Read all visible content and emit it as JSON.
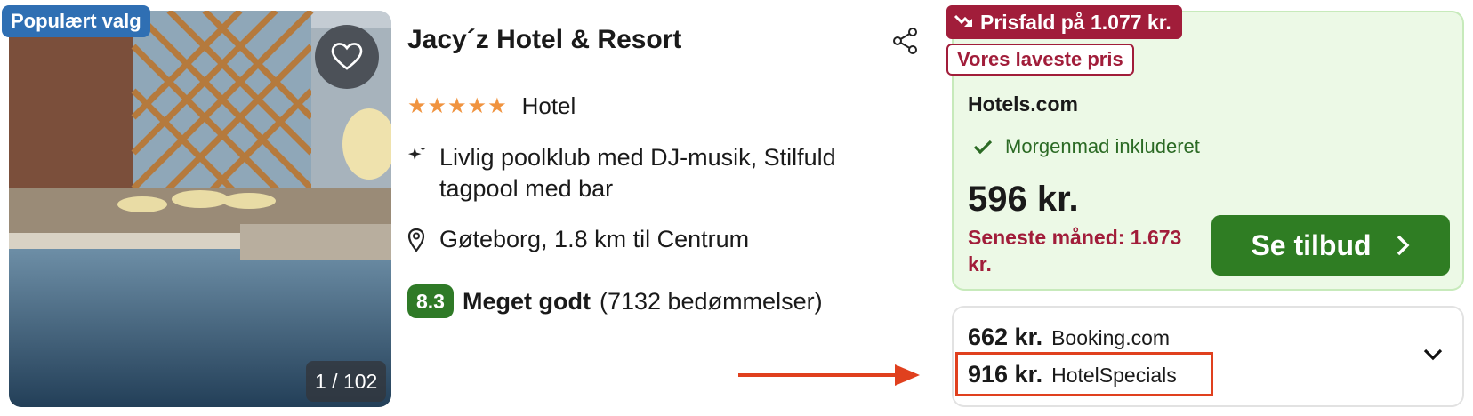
{
  "badges": {
    "popular": "Populært valg",
    "price_drop": "Prisfald på 1.077 kr.",
    "lowest": "Vores laveste pris"
  },
  "gallery": {
    "counter": "1 / 102"
  },
  "hotel": {
    "name": "Jacy´z Hotel & Resort",
    "stars": "★★★★★",
    "type": "Hotel",
    "features": "Livlig poolklub med DJ-musik, Stilfuld tagpool med bar",
    "location": "Gøteborg, 1.8 km til Centrum",
    "rating": {
      "score": "8.3",
      "label": "Meget godt",
      "count": "(7132 bedømmelser)"
    }
  },
  "offer": {
    "provider": "Hotels.com",
    "amenity": "Morgenmad inkluderet",
    "price": "596 kr.",
    "last_month": "Seneste måned: 1.673 kr.",
    "button": "Se tilbud"
  },
  "others": [
    {
      "price": "662 kr.",
      "name": "Booking.com"
    },
    {
      "price": "916 kr.",
      "name": "HotelSpecials"
    }
  ],
  "colors": {
    "accent_green": "#2f7d23",
    "drop_red": "#a11d3a",
    "badge_blue": "#2f6fb3",
    "highlight_orange": "#e0401e"
  }
}
